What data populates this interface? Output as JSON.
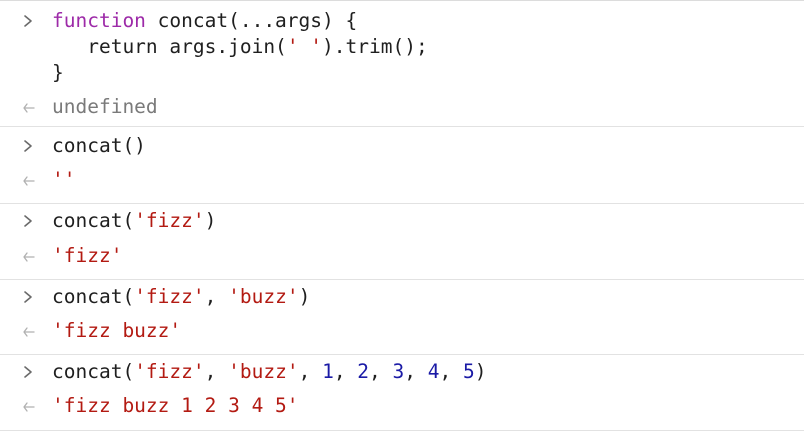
{
  "entries": [
    {
      "input_lines": [
        [
          {
            "t": "function",
            "c": "kw"
          },
          {
            "t": " concat(...args) {",
            "c": "plain"
          }
        ],
        [
          {
            "t": "   return args.join(",
            "c": "plain"
          },
          {
            "t": "' '",
            "c": "str"
          },
          {
            "t": ").trim();",
            "c": "plain"
          }
        ],
        [
          {
            "t": "}",
            "c": "plain"
          }
        ]
      ],
      "output": [
        {
          "t": "undefined",
          "c": "undef"
        }
      ]
    },
    {
      "input_lines": [
        [
          {
            "t": "concat()",
            "c": "plain"
          }
        ]
      ],
      "output": [
        {
          "t": "''",
          "c": "str"
        }
      ]
    },
    {
      "input_lines": [
        [
          {
            "t": "concat(",
            "c": "plain"
          },
          {
            "t": "'fizz'",
            "c": "str"
          },
          {
            "t": ")",
            "c": "plain"
          }
        ]
      ],
      "output": [
        {
          "t": "'fizz'",
          "c": "str"
        }
      ]
    },
    {
      "input_lines": [
        [
          {
            "t": "concat(",
            "c": "plain"
          },
          {
            "t": "'fizz'",
            "c": "str"
          },
          {
            "t": ", ",
            "c": "plain"
          },
          {
            "t": "'buzz'",
            "c": "str"
          },
          {
            "t": ")",
            "c": "plain"
          }
        ]
      ],
      "output": [
        {
          "t": "'fizz buzz'",
          "c": "str"
        }
      ]
    },
    {
      "input_lines": [
        [
          {
            "t": "concat(",
            "c": "plain"
          },
          {
            "t": "'fizz'",
            "c": "str"
          },
          {
            "t": ", ",
            "c": "plain"
          },
          {
            "t": "'buzz'",
            "c": "str"
          },
          {
            "t": ", ",
            "c": "plain"
          },
          {
            "t": "1",
            "c": "num"
          },
          {
            "t": ", ",
            "c": "plain"
          },
          {
            "t": "2",
            "c": "num"
          },
          {
            "t": ", ",
            "c": "plain"
          },
          {
            "t": "3",
            "c": "num"
          },
          {
            "t": ", ",
            "c": "plain"
          },
          {
            "t": "4",
            "c": "num"
          },
          {
            "t": ", ",
            "c": "plain"
          },
          {
            "t": "5",
            "c": "num"
          },
          {
            "t": ")",
            "c": "plain"
          }
        ]
      ],
      "output": [
        {
          "t": "'fizz buzz 1 2 3 4 5'",
          "c": "str"
        }
      ]
    }
  ],
  "icons": {
    "input_prompt": "chevron-right-icon",
    "output_prompt": "return-arrow-icon"
  },
  "colors": {
    "keyword": "#9d2aa8",
    "string": "#b31a12",
    "number": "#1a1aa6",
    "undefined": "#7a7a7a",
    "separator": "#e2e2e2"
  }
}
